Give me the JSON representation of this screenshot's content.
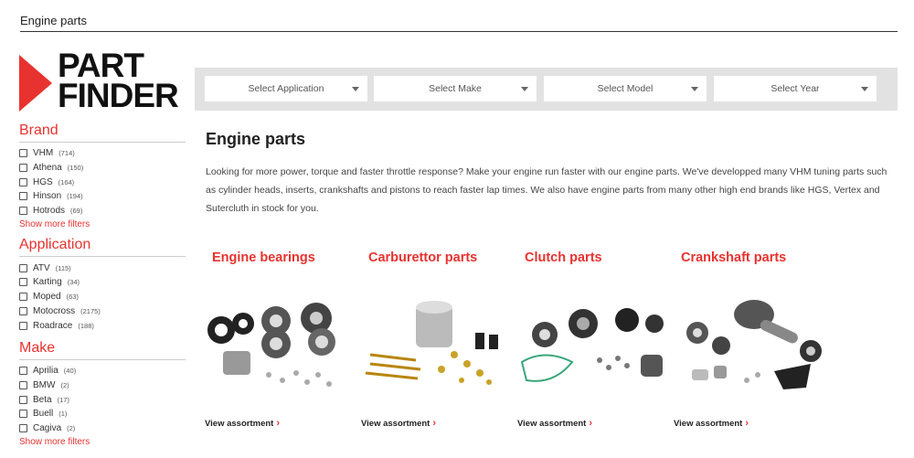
{
  "breadcrumb": {
    "label": "Engine parts"
  },
  "logo": {
    "line1": "PART",
    "line2": "FINDER"
  },
  "filters": [
    {
      "label": "Select Application"
    },
    {
      "label": "Select Make"
    },
    {
      "label": "Select Model"
    },
    {
      "label": "Select Year"
    }
  ],
  "sidebar": {
    "brand": {
      "title": "Brand",
      "items": [
        {
          "label": "VHM",
          "count": "(714)"
        },
        {
          "label": "Athena",
          "count": "(150)"
        },
        {
          "label": "HGS",
          "count": "(164)"
        },
        {
          "label": "Hinson",
          "count": "(194)"
        },
        {
          "label": "Hotrods",
          "count": "(69)"
        }
      ],
      "more": "Show more filters"
    },
    "application": {
      "title": "Application",
      "items": [
        {
          "label": "ATV",
          "count": "(115)"
        },
        {
          "label": "Karting",
          "count": "(34)"
        },
        {
          "label": "Moped",
          "count": "(63)"
        },
        {
          "label": "Motocross",
          "count": "(2175)"
        },
        {
          "label": "Roadrace",
          "count": "(188)"
        }
      ]
    },
    "make": {
      "title": "Make",
      "items": [
        {
          "label": "Aprilia",
          "count": "(40)"
        },
        {
          "label": "BMW",
          "count": "(2)"
        },
        {
          "label": "Beta",
          "count": "(17)"
        },
        {
          "label": "Buell",
          "count": "(1)"
        },
        {
          "label": "Cagiva",
          "count": "(2)"
        }
      ],
      "more": "Show more filters"
    }
  },
  "main": {
    "title": "Engine parts",
    "intro": "Looking for more power, torque and faster throttle response? Make your engine run faster with our engine parts. We've developped many VHM tuning parts such as cylinder heads, inserts, crankshafts and pistons to reach faster lap times. We also have engine parts from many other high end brands like HGS, Vertex and Sutercluth in stock for you.",
    "categories": [
      {
        "title": "Engine bearings",
        "link": "View assortment",
        "icon": "engine-bearings-image"
      },
      {
        "title": "Carburettor parts",
        "link": "View assortment",
        "icon": "carburettor-parts-image"
      },
      {
        "title": "Clutch parts",
        "link": "View assortment",
        "icon": "clutch-parts-image"
      },
      {
        "title": "Crankshaft parts",
        "link": "View assortment",
        "icon": "crankshaft-parts-image"
      }
    ]
  },
  "colors": {
    "accent": "#e8322f",
    "filterbar": "#e2e2e2"
  }
}
